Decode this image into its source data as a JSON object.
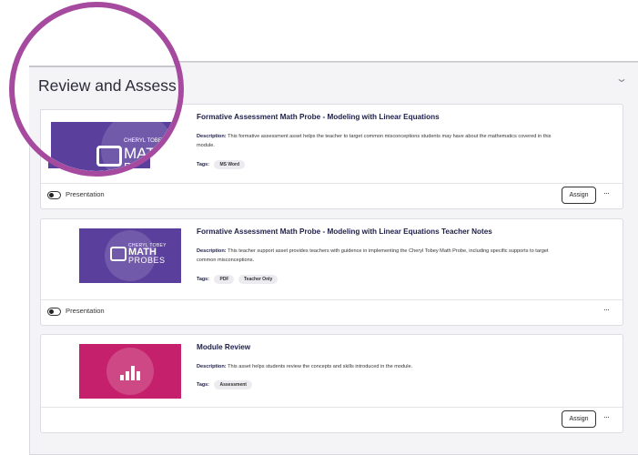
{
  "section": {
    "title": "Review and Assess",
    "collapse_icon": "chevron-down-icon"
  },
  "cards": [
    {
      "title": "Formative Assessment Math Probe - Modeling with Linear Equations",
      "description_label": "Description:",
      "description": "This formative assessment asset helps the teacher to target common misconceptions students may have about the mathematics covered in this module.",
      "tags_label": "Tags:",
      "tags": [
        "MS Word"
      ],
      "thumb_logo_small": "CHERYL TOBEY",
      "thumb_logo_big": "MATH",
      "thumb_logo_big2": "PROBES",
      "toggle_label": "Presentation",
      "assign_label": "Assign",
      "more_label": "···"
    },
    {
      "title": "Formative Assessment Math Probe - Modeling with Linear Equations Teacher Notes",
      "description_label": "Description:",
      "description": "This teacher support asset provides teachers with guidence in implementing the Cheryl Tobey Math Probe, including specific supports to target common misconceptions.",
      "tags_label": "Tags:",
      "tags": [
        "PDF",
        "Teacher Only"
      ],
      "thumb_logo_small": "CHERYL TOBEY",
      "thumb_logo_big": "MATH",
      "thumb_logo_big2": "PROBES",
      "toggle_label": "Presentation",
      "more_label": "···"
    },
    {
      "title": "Module Review",
      "description_label": "Description:",
      "description": "This asset helps students review the concepts and skills introduced in the module.",
      "tags_label": "Tags:",
      "tags": [
        "Assessment"
      ],
      "thumb_icon": "bar-chart-icon",
      "assign_label": "Assign",
      "more_label": "···"
    }
  ],
  "colors": {
    "magnifier_ring": "#a54a9f",
    "thumb_purple": "#5b3f9c",
    "thumb_pink": "#c4206b"
  }
}
